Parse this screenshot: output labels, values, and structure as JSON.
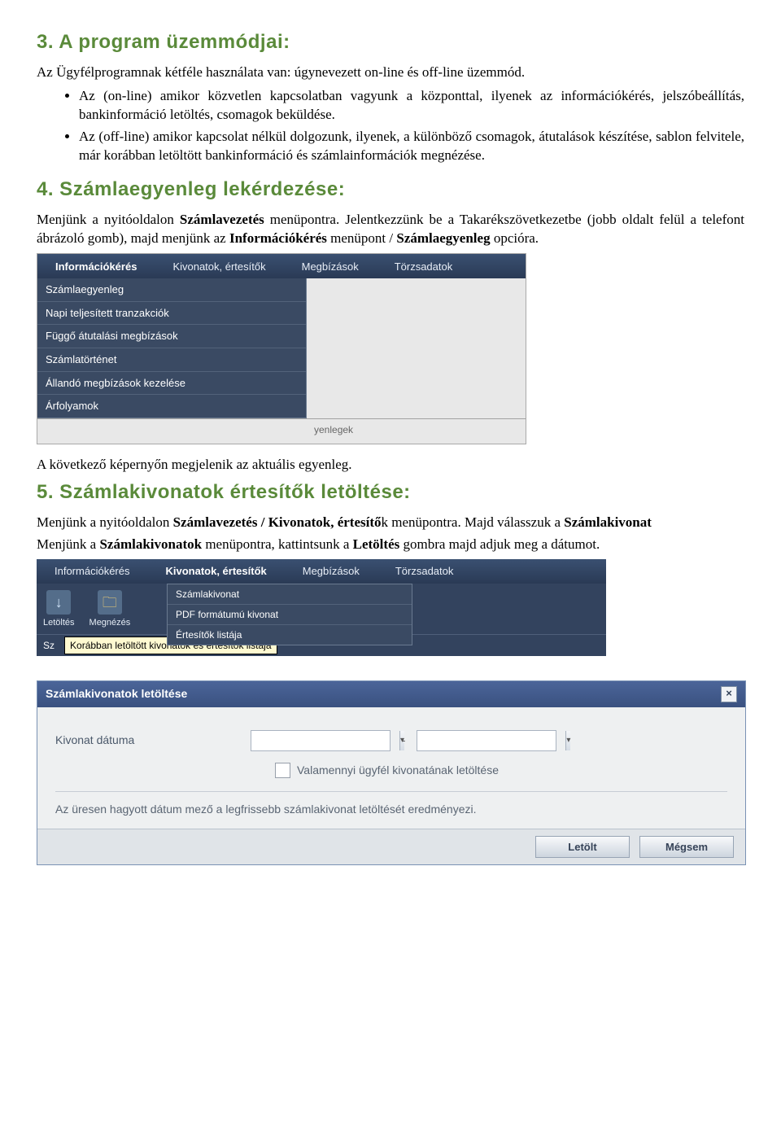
{
  "s3": {
    "heading": "3. A program üzemmódjai:",
    "intro": "Az Ügyfélprogramnak kétféle használata van: úgynevezett on-line és off-line üzemmód.",
    "bullets": [
      "Az (on-line) amikor közvetlen kapcsolatban vagyunk a központtal, ilyenek az információkérés, jelszóbeállítás, bankinformáció letöltés, csomagok beküldése.",
      "Az (off-line) amikor kapcsolat nélkül dolgozunk, ilyenek, a különböző csomagok, átutalások készítése, sablon felvitele, már korábban letöltött bankinformáció és számlainformációk megnézése."
    ]
  },
  "s4": {
    "heading": "4. Számlaegyenleg lekérdezése:",
    "p_before1": "Menjünk a nyitóoldalon ",
    "p_bold1": "Számlavezetés",
    "p_middle1": " menüpontra. Jelentkezzünk be a Takarékszövetkezetbe (jobb oldalt felül a telefont ábrázoló gomb), majd menjünk az ",
    "p_bold2": "Információkérés",
    "p_after2": " menüpont / ",
    "p_bold3": "Számlaegyenleg",
    "p_after3": " opcióra.",
    "tabs": [
      "Információkérés",
      "Kivonatok, értesítők",
      "Megbízások",
      "Törzsadatok"
    ],
    "dropdown": [
      "Számlaegyenleg",
      "Napi teljesített tranzakciók",
      "Függő átutalási megbízások",
      "Számlatörténet",
      "Állandó megbízások kezelése",
      "Árfolyamok"
    ],
    "bottom_label": "yenlegek",
    "followup": "A következő képernyőn megjelenik az aktuális egyenleg."
  },
  "s5": {
    "heading": "5. Számlakivonatok értesítők letöltése:",
    "p1_a": "Menjünk a nyitóoldalon ",
    "p1_b": "Számlavezetés / Kivonatok, értesítő",
    "p1_c": "k menüpontra. Majd válasszuk a ",
    "p1_d": "Számlakivonat",
    "p2_a": "Menjünk a ",
    "p2_b": "Számlakivonatok",
    "p2_c": " menüpontra, kattintsunk a ",
    "p2_d": "Letöltés",
    "p2_e": " gombra majd adjuk meg a dátumot.",
    "tabs2": [
      "Információkérés",
      "Kivonatok, értesítők",
      "Megbízások",
      "Törzsadatok"
    ],
    "toolbar": {
      "download": "Letöltés",
      "view": "Megnézés"
    },
    "dropdown2": [
      "Számlakivonat",
      "PDF formátumú kivonat",
      "Értesítők listája"
    ],
    "tooltip_prefix": "Sz",
    "tooltip": "Korábban letöltött kivonatok és értesítők listája"
  },
  "dlg": {
    "title": "Számlakivonatok letöltése",
    "label_date": "Kivonat dátuma",
    "dash": "-",
    "check_label": "Valamennyi ügyfél kivonatának letöltése",
    "hint": "Az üresen hagyott dátum mező a legfrissebb számlakivonat letöltését eredményezi.",
    "btn_download": "Letölt",
    "btn_cancel": "Mégsem",
    "close": "×"
  }
}
